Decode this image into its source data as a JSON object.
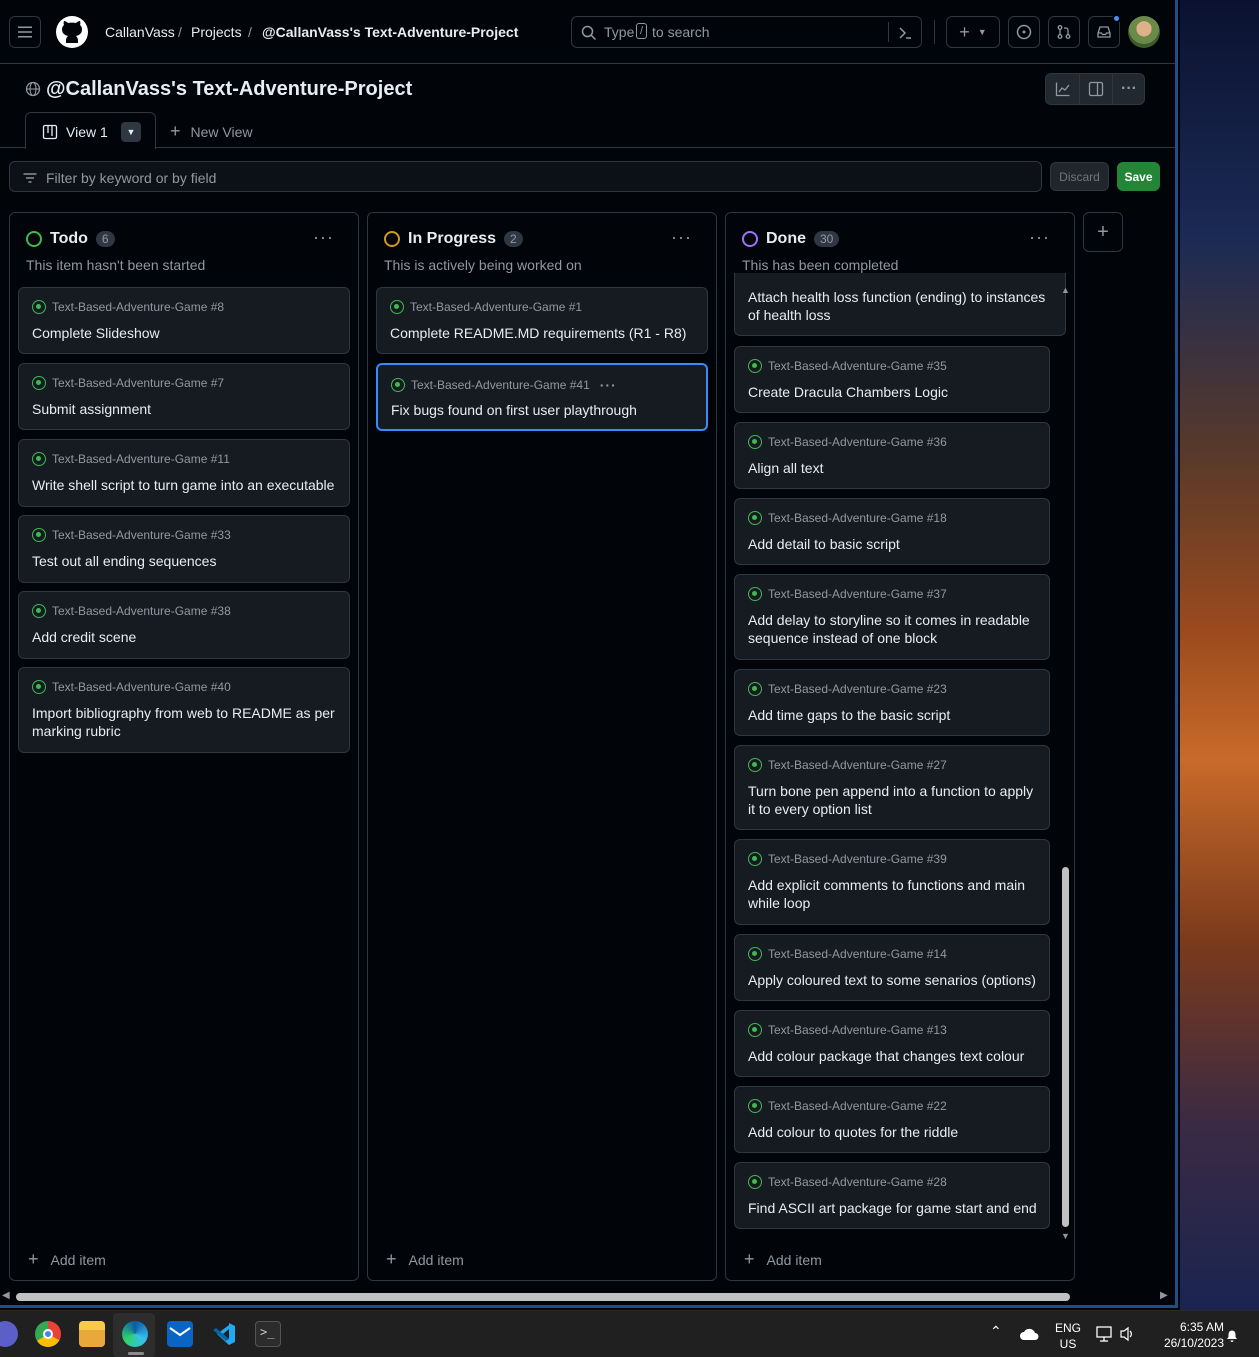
{
  "header": {
    "breadcrumb_user": "CallanVass",
    "breadcrumb_projects": "Projects",
    "breadcrumb_project": "@CallanVass's Text-Adventure-Project",
    "search_prefix": "Type",
    "search_key": "/",
    "search_suffix": "to search"
  },
  "project": {
    "title": "@CallanVass's Text-Adventure-Project",
    "tab_label": "View 1",
    "new_view_label": "New View",
    "filter_placeholder": "Filter by keyword or by field",
    "discard_label": "Discard",
    "save_label": "Save"
  },
  "columns": [
    {
      "name": "Todo",
      "count": "6",
      "description": "This item hasn't been started",
      "color": "#3fb950",
      "cards": [
        {
          "repo": "Text-Based-Adventure-Game #8",
          "title": "Complete Slideshow"
        },
        {
          "repo": "Text-Based-Adventure-Game #7",
          "title": "Submit assignment"
        },
        {
          "repo": "Text-Based-Adventure-Game #11",
          "title": "Write shell script to turn game into an executable"
        },
        {
          "repo": "Text-Based-Adventure-Game #33",
          "title": "Test out all ending sequences"
        },
        {
          "repo": "Text-Based-Adventure-Game #38",
          "title": "Add credit scene"
        },
        {
          "repo": "Text-Based-Adventure-Game #40",
          "title": "Import bibliography from web to README as per marking rubric"
        }
      ]
    },
    {
      "name": "In Progress",
      "count": "2",
      "description": "This is actively being worked on",
      "color": "#d29922",
      "cards": [
        {
          "repo": "Text-Based-Adventure-Game #1",
          "title": "Complete README.MD requirements (R1 - R8)"
        },
        {
          "repo": "Text-Based-Adventure-Game #41",
          "title": "Fix bugs found on first user playthrough"
        }
      ]
    },
    {
      "name": "Done",
      "count": "30",
      "description": "This has been completed",
      "color": "#a371f7",
      "partial_title": "Attach health loss function (ending) to instances of health loss",
      "cards": [
        {
          "repo": "Text-Based-Adventure-Game #35",
          "title": "Create Dracula Chambers Logic"
        },
        {
          "repo": "Text-Based-Adventure-Game #36",
          "title": "Align all text"
        },
        {
          "repo": "Text-Based-Adventure-Game #18",
          "title": "Add detail to basic script"
        },
        {
          "repo": "Text-Based-Adventure-Game #37",
          "title": "Add delay to storyline so it comes in readable sequence instead of one block"
        },
        {
          "repo": "Text-Based-Adventure-Game #23",
          "title": "Add time gaps to the basic script"
        },
        {
          "repo": "Text-Based-Adventure-Game #27",
          "title": "Turn bone pen append into a function to apply it to every option list"
        },
        {
          "repo": "Text-Based-Adventure-Game #39",
          "title": "Add explicit comments to functions and main while loop"
        },
        {
          "repo": "Text-Based-Adventure-Game #14",
          "title": "Apply coloured text to some senarios (options)"
        },
        {
          "repo": "Text-Based-Adventure-Game #13",
          "title": "Add colour package that changes text colour"
        },
        {
          "repo": "Text-Based-Adventure-Game #22",
          "title": "Add colour to quotes for the riddle"
        },
        {
          "repo": "Text-Based-Adventure-Game #28",
          "title": "Find ASCII art package for game start and end"
        }
      ]
    }
  ],
  "add_item_label": "Add item",
  "taskbar": {
    "lang_line1": "ENG",
    "lang_line2": "US",
    "time": "6:35 AM",
    "date": "26/10/2023"
  }
}
